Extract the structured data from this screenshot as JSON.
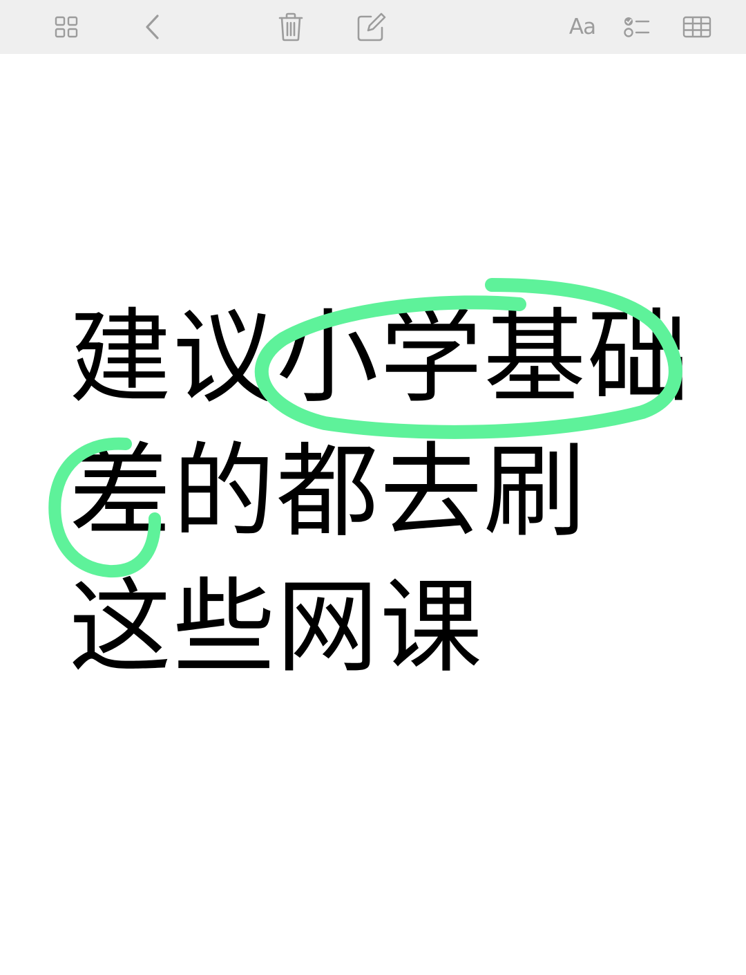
{
  "toolbar": {
    "aa_label": "Aa",
    "icon_color": "#9c9c9c",
    "background": "#efefef",
    "icons": [
      "gallery-grid-icon",
      "back-chevron-icon",
      "trash-icon",
      "compose-icon",
      "text-format-icon",
      "checklist-icon",
      "table-icon"
    ]
  },
  "note": {
    "lines": [
      "建议小学基础",
      "差的都去刷",
      "这些网课"
    ],
    "text_color": "#000000"
  },
  "annotation": {
    "highlight_color": "#5ef29a",
    "circled_text": [
      "小学基础",
      "差"
    ]
  }
}
